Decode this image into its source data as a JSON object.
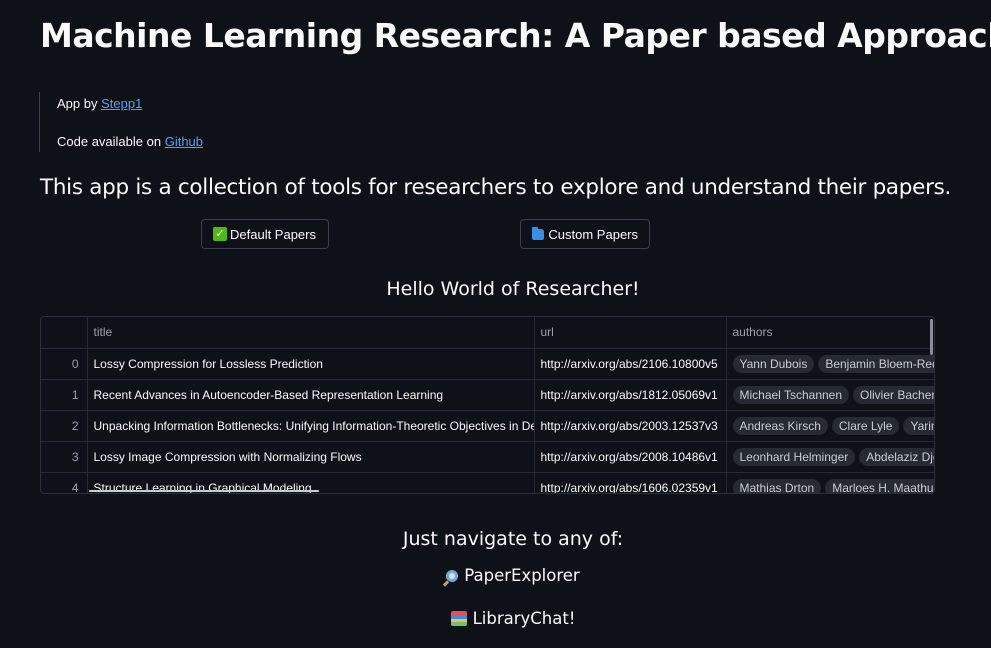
{
  "title": "Machine Learning Research: A Paper based Approach",
  "credits": {
    "app_by_prefix": "App by ",
    "app_by_link": "Stepp1",
    "code_prefix": "Code available on ",
    "code_link": "Github"
  },
  "intro": "This app is a collection of tools for researchers to explore and understand their papers.",
  "buttons": {
    "default": {
      "icon": "check-mark-icon",
      "label": "Default Papers"
    },
    "custom": {
      "icon": "folder-icon",
      "label": "Custom Papers"
    }
  },
  "hello": "Hello World of Researcher!",
  "table": {
    "columns": [
      "",
      "title",
      "url",
      "authors"
    ],
    "rows": [
      {
        "idx": "0",
        "title": "Lossy Compression for Lossless Prediction",
        "url": "http://arxiv.org/abs/2106.10800v5",
        "authors": [
          "Yann Dubois",
          "Benjamin Bloem-Reddy"
        ]
      },
      {
        "idx": "1",
        "title": "Recent Advances in Autoencoder-Based Representation Learning",
        "url": "http://arxiv.org/abs/1812.05069v1",
        "authors": [
          "Michael Tschannen",
          "Olivier Bachem"
        ]
      },
      {
        "idx": "2",
        "title": "Unpacking Information Bottlenecks: Unifying Information-Theoretic Objectives in Deep Learning",
        "url": "http://arxiv.org/abs/2003.12537v3",
        "authors": [
          "Andreas Kirsch",
          "Clare Lyle",
          "Yarin Gal"
        ]
      },
      {
        "idx": "3",
        "title": "Lossy Image Compression with Normalizing Flows",
        "url": "http://arxiv.org/abs/2008.10486v1",
        "authors": [
          "Leonhard Helminger",
          "Abdelaziz Djelouah"
        ]
      },
      {
        "idx": "4",
        "title": "Structure Learning in Graphical Modeling",
        "url": "http://arxiv.org/abs/1606.02359v1",
        "authors": [
          "Mathias Drton",
          "Marloes H. Maathuis"
        ]
      }
    ]
  },
  "nav": {
    "heading": "Just navigate to any of:",
    "items": [
      {
        "icon": "magnifier-icon",
        "label": "PaperExplorer"
      },
      {
        "icon": "books-icon",
        "label": "LibraryChat!"
      }
    ]
  }
}
